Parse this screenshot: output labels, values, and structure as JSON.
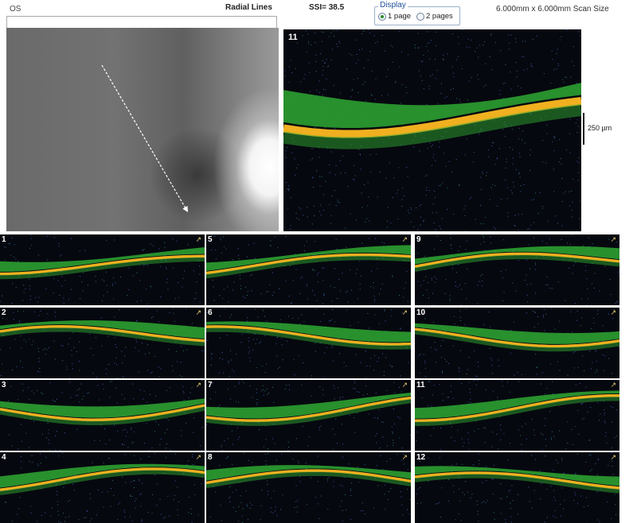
{
  "header": {
    "eye": "OS",
    "scan_type": "Radial Lines",
    "ssi": "SSI= 38.5",
    "display_legend": "Display",
    "display_options": [
      {
        "label": "1 page",
        "selected": true
      },
      {
        "label": "2 pages",
        "selected": false
      }
    ],
    "scan_size": "6.000mm x 6.000mm Scan Size"
  },
  "main_scan": {
    "slice_number": "11",
    "scale_label": "250 µm"
  },
  "slices": [
    {
      "number": "1"
    },
    {
      "number": "5"
    },
    {
      "number": "9"
    },
    {
      "number": "2"
    },
    {
      "number": "6"
    },
    {
      "number": "10"
    },
    {
      "number": "3"
    },
    {
      "number": "7"
    },
    {
      "number": "11"
    },
    {
      "number": "4"
    },
    {
      "number": "8"
    },
    {
      "number": "12"
    }
  ],
  "colors": {
    "retina_layer": "#2fa832",
    "rpe_band": "#f0b020",
    "noise": "#3a5aa8",
    "background": "#06080f"
  }
}
